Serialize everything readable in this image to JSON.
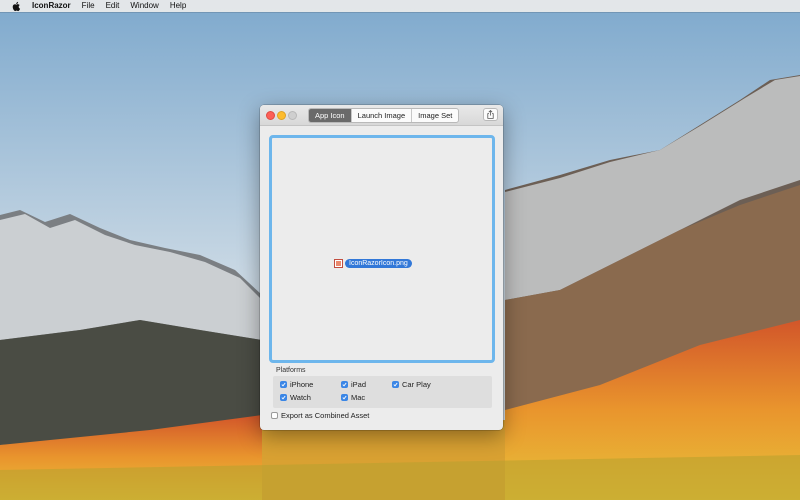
{
  "menubar": {
    "apple_icon": "apple-icon",
    "app_name": "IconRazor",
    "menus": [
      "File",
      "Edit",
      "Window",
      "Help"
    ]
  },
  "window": {
    "tabs": [
      "App Icon",
      "Launch Image",
      "Image Set"
    ],
    "active_tab": "App Icon",
    "share_icon": "share-icon",
    "dropzone": {
      "file_name": "IconRazorIcon.png",
      "accent": "#6db6ec"
    },
    "platforms": {
      "label": "Platforms",
      "options": [
        {
          "label": "iPhone",
          "checked": true
        },
        {
          "label": "iPad",
          "checked": true
        },
        {
          "label": "Car Play",
          "checked": true
        },
        {
          "label": "Watch",
          "checked": true
        },
        {
          "label": "Mac",
          "checked": true
        }
      ]
    },
    "export_combined": {
      "label": "Export as Combined Asset",
      "checked": false
    }
  },
  "colors": {
    "checkbox_on": "#3a86e6",
    "close": "#fc5f57",
    "minimize": "#fdbc2e"
  }
}
